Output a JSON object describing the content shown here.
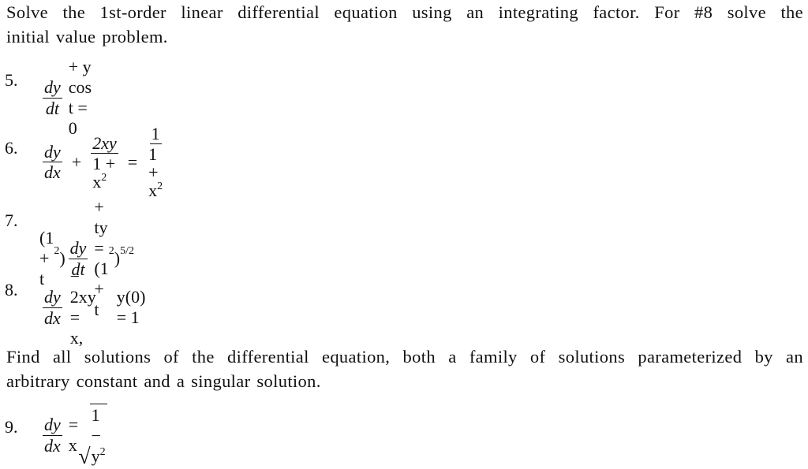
{
  "instructions": {
    "line1": "Solve the 1st-order linear differential equation using an integrating factor. For #8 solve the",
    "line2": "initial value problem."
  },
  "problems": [
    {
      "number": "5.",
      "frac_num": "dy",
      "frac_den": "dt",
      "rest": "+ y cos t = 0"
    },
    {
      "number": "6.",
      "frac1_num": "dy",
      "frac1_den": "dx",
      "plus": "+",
      "frac2_num": "2xy",
      "frac2_den_base": "1 + x",
      "frac2_den_exp": "2",
      "equals": "=",
      "frac3_num": "1",
      "frac3_den_base": "1 + x",
      "frac3_den_exp": "2"
    },
    {
      "number": "7.",
      "lhs_pre": "(1 + t",
      "lhs_pre_exp": "2",
      "lhs_pre_close": ")",
      "frac_num": "dy",
      "frac_den": "dt",
      "mid": "+ ty = (1 + t",
      "mid_exp": "2",
      "mid_close": ")",
      "rhs_exp": "5/2"
    },
    {
      "number": "8.",
      "frac_num": "dy",
      "frac_den": "dx",
      "rest": "− 2xy = x,",
      "condition": "y(0) = 1"
    },
    {
      "number": "9.",
      "frac_num": "dy",
      "frac_den": "dx",
      "equals": "= x",
      "sqrt_body": "1 − y",
      "sqrt_exp": "2"
    }
  ],
  "section2": {
    "line1": "Find all solutions of the differential equation, both a family of solutions parameterized by an",
    "line2": "arbitrary constant and a singular solution."
  }
}
